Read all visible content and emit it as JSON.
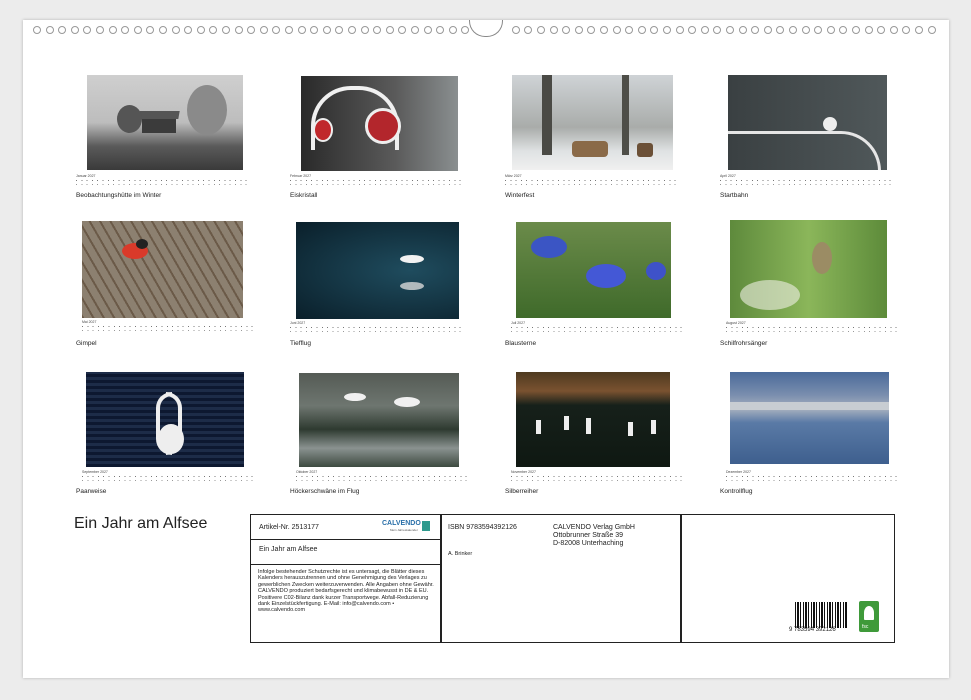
{
  "calendar": {
    "title": "Ein Jahr am Alfsee",
    "months": [
      {
        "label": "Januar 2027",
        "caption": "Beobachtungshütte im Winter"
      },
      {
        "label": "Februar 2027",
        "caption": "Eiskristall"
      },
      {
        "label": "März 2027",
        "caption": "Winterfest"
      },
      {
        "label": "April 2027",
        "caption": "Startbahn"
      },
      {
        "label": "Mai 2027",
        "caption": "Gimpel"
      },
      {
        "label": "Juni 2027",
        "caption": "Tiefflug"
      },
      {
        "label": "Juli 2027",
        "caption": "Blausterne"
      },
      {
        "label": "August 2027",
        "caption": "Schilfrohrsänger"
      },
      {
        "label": "September 2027",
        "caption": "Paarweise"
      },
      {
        "label": "Oktober 2027",
        "caption": "Höckerschwäne im Flug"
      },
      {
        "label": "November 2027",
        "caption": "Silberreiher"
      },
      {
        "label": "Dezember 2027",
        "caption": "Kontrollflug"
      }
    ]
  },
  "info": {
    "article": "Artikel-Nr. 2513177",
    "logo": "CALVENDO",
    "logo_sub": "Mein Jahreskalender",
    "title": "Ein Jahr am Alfsee",
    "legal": "Infolge bestehender Schutzrechte ist es untersagt, die Blätter dieses Kalenders herauszutrennen und ohne Genehmigung des Verlages zu gewerblichen Zwecken weiterzuverwenden. Alle Angaben ohne Gewähr. CALVENDO produziert bedarfsgerecht und klimabewusst in DE & EU. Positivere C02-Bilanz dank kurzer Transportwege. Abfall-Reduzierung dank Einzelstückfertigung. E-Mail: info@calvendo.com • www.calvendo.com",
    "isbn": "ISBN 9783594392126",
    "publisher_1": "CALVENDO Verlag GmbH",
    "publisher_2": "Ottobrunner Straße 39",
    "publisher_3": "D-82008 Unterhaching",
    "author": "A. Brinker",
    "barcode_digits": "9 783594 392126",
    "fsc_label": "fsc"
  }
}
